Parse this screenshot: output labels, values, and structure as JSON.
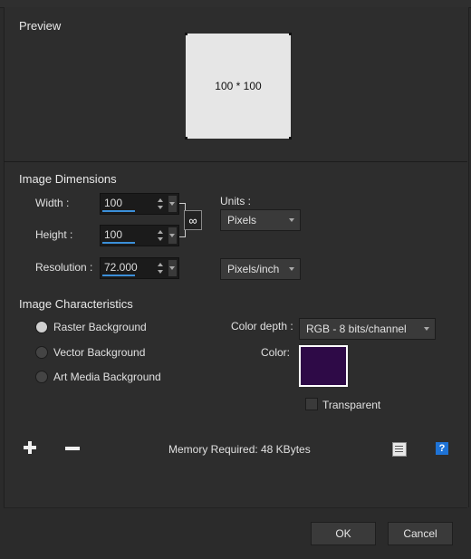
{
  "preview": {
    "title": "Preview",
    "size_text": "100 * 100"
  },
  "dimensions": {
    "title": "Image Dimensions",
    "width_label": "Width :",
    "width_value": "100",
    "height_label": "Height :",
    "height_value": "100",
    "resolution_label": "Resolution :",
    "resolution_value": "72.000",
    "units_label": "Units :",
    "units_value": "Pixels",
    "resolution_units_value": "Pixels/inch"
  },
  "characteristics": {
    "title": "Image Characteristics",
    "options": [
      "Raster Background",
      "Vector Background",
      "Art Media Background"
    ],
    "selected_index": 0,
    "color_depth_label": "Color depth :",
    "color_depth_value": "RGB - 8 bits/channel",
    "color_label": "Color:",
    "color_value": "#2e0a47",
    "transparent_label": "Transparent"
  },
  "footer": {
    "add_icon": "plus-icon",
    "remove_icon": "minus-icon",
    "memory_label": "Memory Required:",
    "memory_value": "48 KBytes",
    "ok_label": "OK",
    "cancel_label": "Cancel"
  }
}
